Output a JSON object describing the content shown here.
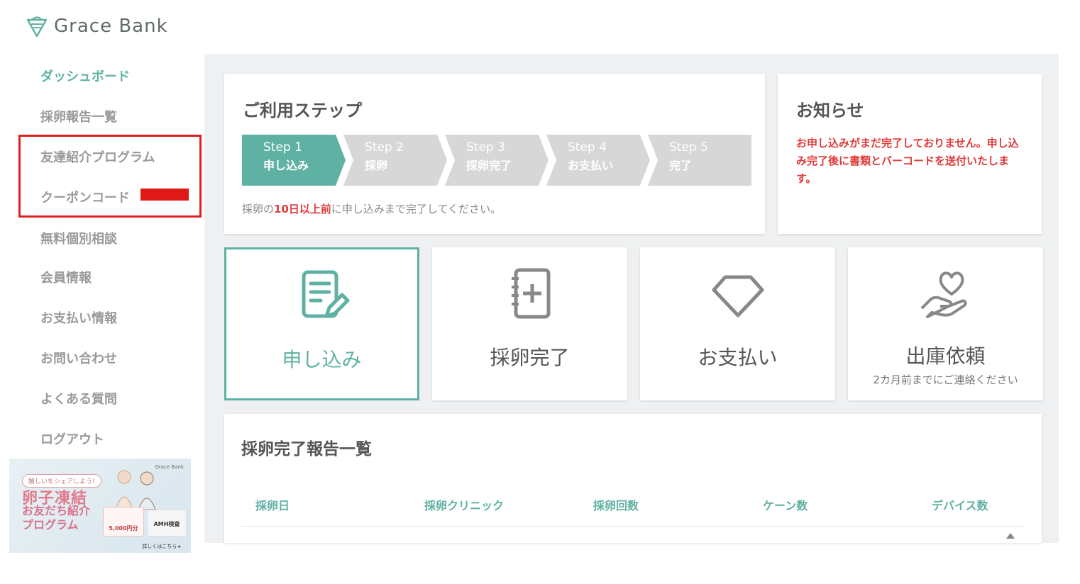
{
  "brand": {
    "name": "Grace Bank",
    "accent": "#5fb1a3",
    "alert": "#e03a3a"
  },
  "sidebar": {
    "items": [
      {
        "label": "ダッシュボード",
        "active": true
      },
      {
        "label": "採卵報告一覧"
      },
      {
        "label": "友達紹介プログラム"
      },
      {
        "label": "クーポンコード"
      },
      {
        "label": "無料個別相談"
      },
      {
        "label": "会員情報"
      },
      {
        "label": "お支払い情報"
      },
      {
        "label": "お問い合わせ"
      },
      {
        "label": "よくある質問"
      },
      {
        "label": "ログアウト"
      }
    ]
  },
  "banner": {
    "pill": "嬉しいをシェアしよう!",
    "title": "卵子凍結",
    "subtitle": "お友だち紹介プログラム",
    "brand": "Grace Bank",
    "card1": "5,000円分",
    "card2": "AMH検査",
    "more": "詳しくはこちら ▸"
  },
  "steps_card": {
    "title": "ご利用ステップ",
    "steps": [
      {
        "num": "Step 1",
        "label": "申し込み",
        "active": true
      },
      {
        "num": "Step 2",
        "label": "採卵"
      },
      {
        "num": "Step 3",
        "label": "採卵完了"
      },
      {
        "num": "Step 4",
        "label": "お支払い"
      },
      {
        "num": "Step 5",
        "label": "完了"
      }
    ],
    "note_pre": "採卵の",
    "note_em": "10日以上前",
    "note_post": "に申し込みまで完了してください。"
  },
  "notice": {
    "title": "お知らせ",
    "text": "お申し込みがまだ完了しておりません。申し込み完了後に書類とバーコードを送付いたします。"
  },
  "actions": [
    {
      "label": "申し込み",
      "icon": "document-edit-icon",
      "active": true
    },
    {
      "label": "採卵完了",
      "icon": "notebook-plus-icon"
    },
    {
      "label": "お支払い",
      "icon": "diamond-icon"
    },
    {
      "label": "出庫依頼",
      "sub": "2カ月前までにご連絡ください",
      "icon": "heart-hand-icon"
    }
  ],
  "report_table": {
    "title": "採卵完了報告一覧",
    "columns": [
      "採卵日",
      "採卵クリニック",
      "採卵回数",
      "ケーン数",
      "デバイス数"
    ]
  }
}
